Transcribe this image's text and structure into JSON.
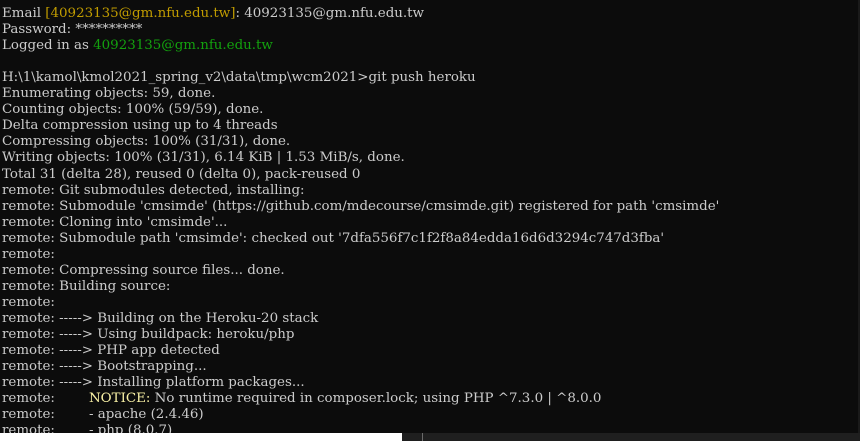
{
  "terminal": {
    "lines": [
      [
        {
          "t": ""
        }
      ],
      [
        {
          "t": "Email "
        },
        {
          "t": "[40923135@gm.nfu.edu.tw]",
          "c": "orange"
        },
        {
          "t": ": 40923135@gm.nfu.edu.tw"
        }
      ],
      [
        {
          "t": "Password: **********"
        }
      ],
      [
        {
          "t": "Logged in as "
        },
        {
          "t": "40923135@gm.nfu.edu.tw",
          "c": "green"
        }
      ],
      [
        {
          "t": ""
        }
      ],
      [
        {
          "t": "H:\\1\\kamol\\kmol2021_spring_v2\\data\\tmp\\wcm2021>git push heroku"
        }
      ],
      [
        {
          "t": "Enumerating objects: 59, done."
        }
      ],
      [
        {
          "t": "Counting objects: 100% (59/59), done."
        }
      ],
      [
        {
          "t": "Delta compression using up to 4 threads"
        }
      ],
      [
        {
          "t": "Compressing objects: 100% (31/31), done."
        }
      ],
      [
        {
          "t": "Writing objects: 100% (31/31), 6.14 KiB | 1.53 MiB/s, done."
        }
      ],
      [
        {
          "t": "Total 31 (delta 28), reused 0 (delta 0), pack-reused 0"
        }
      ],
      [
        {
          "t": "remote: Git submodules detected, installing:"
        }
      ],
      [
        {
          "t": "remote: Submodule 'cmsimde' (https://github.com/mdecourse/cmsimde.git) registered for path 'cmsimde'"
        }
      ],
      [
        {
          "t": "remote: Cloning into 'cmsimde'..."
        }
      ],
      [
        {
          "t": "remote: Submodule path 'cmsimde': checked out '7dfa556f7c1f2f8a84edda16d6d3294c747d3fba'"
        }
      ],
      [
        {
          "t": "remote:"
        }
      ],
      [
        {
          "t": "remote: Compressing source files... done."
        }
      ],
      [
        {
          "t": "remote: Building source:"
        }
      ],
      [
        {
          "t": "remote:"
        }
      ],
      [
        {
          "t": "remote: -----> Building on the Heroku-20 stack"
        }
      ],
      [
        {
          "t": "remote: -----> Using buildpack: heroku/php"
        }
      ],
      [
        {
          "t": "remote: -----> PHP app detected"
        }
      ],
      [
        {
          "t": "remote: -----> Bootstrapping..."
        }
      ],
      [
        {
          "t": "remote: -----> Installing platform packages..."
        }
      ],
      [
        {
          "t": "remote:        "
        },
        {
          "t": "NOTICE:",
          "c": "yellow"
        },
        {
          "t": " No runtime required in composer.lock; using PHP ^7.3.0 | ^8.0.0"
        }
      ],
      [
        {
          "t": "remote:        - apache (2.4.46)"
        }
      ],
      [
        {
          "t": "remote:        - php (8.0.7)"
        }
      ]
    ]
  },
  "colors": {
    "background": "#0c0c0c",
    "text": "#cccccc",
    "orange": "#c19c00",
    "green": "#13a10e",
    "yellow": "#f9f1a5"
  }
}
